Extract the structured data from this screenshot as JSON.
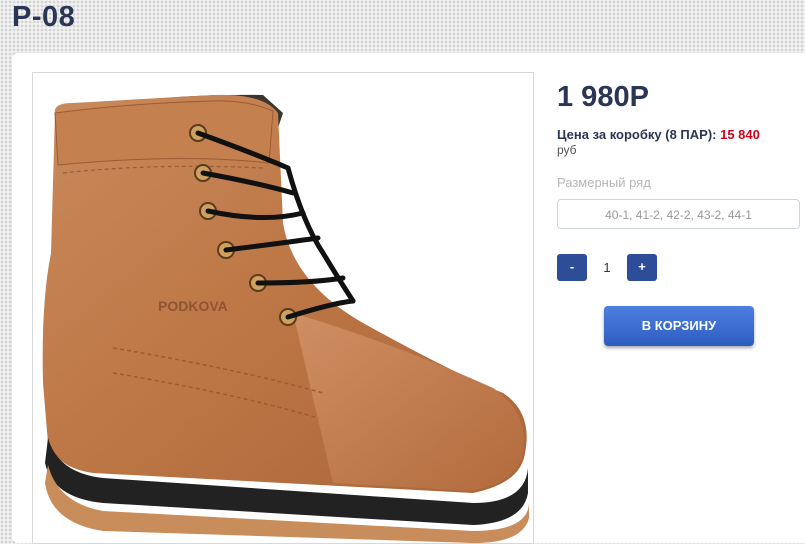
{
  "page": {
    "title": "P-08"
  },
  "product": {
    "image_alt": "PODKOVA boot",
    "logo_text": "PODKOVA",
    "price": "1 980Р",
    "box_price_label": "Цена за коробку (8 ПАР): ",
    "box_price_value": "15 840",
    "currency": "руб",
    "size_label": "Размерный ряд",
    "sizes": "40-1, 41-2, 42-2, 43-2, 44-1",
    "qty_minus": "-",
    "qty_value": "1",
    "qty_plus": "+",
    "cart_button": "В КОРЗИНУ"
  },
  "colors": {
    "title": "#2b3656",
    "price_red": "#d0021b",
    "button_blue": "#2d4d98",
    "cart_blue": "#3b6ad0",
    "leather": "#c07a4c"
  }
}
